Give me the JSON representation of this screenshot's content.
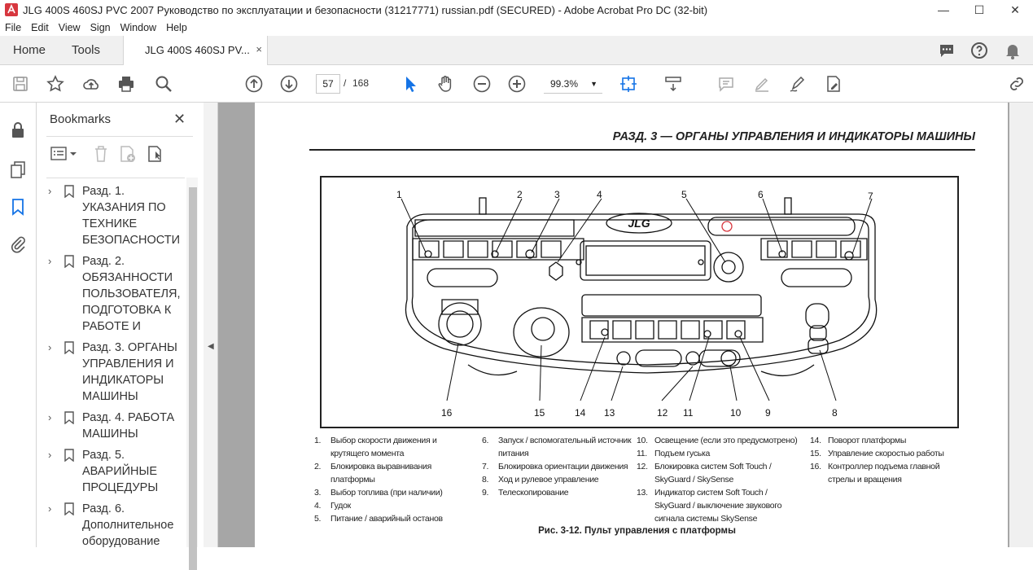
{
  "window": {
    "title": "JLG 400S 460SJ PVC 2007 Руководство по эксплуатации и безопасности (31217771) russian.pdf (SECURED) - Adobe Acrobat Pro DC (32-bit)",
    "minimize": "—",
    "maximize": "☐",
    "close": "✕"
  },
  "menu": [
    "File",
    "Edit",
    "View",
    "Sign",
    "Window",
    "Help"
  ],
  "tabs": {
    "home": "Home",
    "tools": "Tools",
    "document": "JLG 400S 460SJ PV...",
    "close": "×"
  },
  "toolbar": {
    "current_page": "57",
    "separator": "/",
    "total_pages": "168",
    "zoom": "99.3%",
    "zoom_caret": "▼"
  },
  "bookmarks": {
    "title": "Bookmarks",
    "close": "✕",
    "items": [
      {
        "chev": "›",
        "label": "Разд. 1. УКАЗАНИЯ ПО ТЕХНИКЕ БЕЗОПАСНОСТИ"
      },
      {
        "chev": "›",
        "label": "Разд. 2. ОБЯЗАННОСТИ ПОЛЬЗОВАТЕЛЯ, ПОДГОТОВКА К РАБОТЕ И"
      },
      {
        "chev": "›",
        "label": "Разд. 3. ОРГАНЫ УПРАВЛЕНИЯ И ИНДИКАТОРЫ МАШИНЫ"
      },
      {
        "chev": "›",
        "label": "Разд. 4. РАБОТА МАШИНЫ"
      },
      {
        "chev": "›",
        "label": "Разд. 5. АВАРИЙНЫЕ ПРОЦЕДУРЫ"
      },
      {
        "chev": "›",
        "label": "Разд. 6. Дополнительное оборудование"
      }
    ]
  },
  "splitter_arrow": "◀",
  "document": {
    "section_header": "РАЗД. 3 — ОРГАНЫ УПРАВЛЕНИЯ И ИНДИКАТОРЫ МАШИНЫ",
    "logo": "JLG",
    "callouts": [
      "1",
      "2",
      "3",
      "4",
      "5",
      "6",
      "7",
      "8",
      "9",
      "10",
      "11",
      "12",
      "13",
      "14",
      "15",
      "16"
    ],
    "legend_col1": [
      {
        "num": "1.",
        "text": "Выбор скорости движения и крутящего момента"
      },
      {
        "num": "2.",
        "text": "Блокировка выравнивания платформы"
      },
      {
        "num": "3.",
        "text": "Выбор топлива (при наличии)"
      },
      {
        "num": "4.",
        "text": "Гудок"
      },
      {
        "num": "5.",
        "text": "Питание / аварийный останов"
      }
    ],
    "legend_col2": [
      {
        "num": "6.",
        "text": "Запуск / вспомогательный источник питания"
      },
      {
        "num": "7.",
        "text": "Блокировка ориентации движения"
      },
      {
        "num": "8.",
        "text": "Ход и рулевое управление"
      },
      {
        "num": "9.",
        "text": "Телескопирование"
      }
    ],
    "legend_col3": [
      {
        "num": "10.",
        "text": "Освещение (если это предусмотрено)"
      },
      {
        "num": "11.",
        "text": "Подъем гуська"
      },
      {
        "num": "12.",
        "text": "Блокировка систем Soft Touch / SkyGuard / SkySense"
      },
      {
        "num": "13.",
        "text": "Индикатор систем Soft Touch / SkyGuard / выключение звукового сигнала системы SkySense"
      }
    ],
    "legend_col4": [
      {
        "num": "14.",
        "text": "Поворот платформы"
      },
      {
        "num": "15.",
        "text": "Управление скоростью работы"
      },
      {
        "num": "16.",
        "text": "Контроллер подъема главной стрелы и вращения"
      }
    ],
    "caption": "Рис. 3-12. Пульт управления с платформы"
  },
  "colors": {
    "accent_blue": "#1473e6",
    "adobe_red": "#d7373f"
  }
}
